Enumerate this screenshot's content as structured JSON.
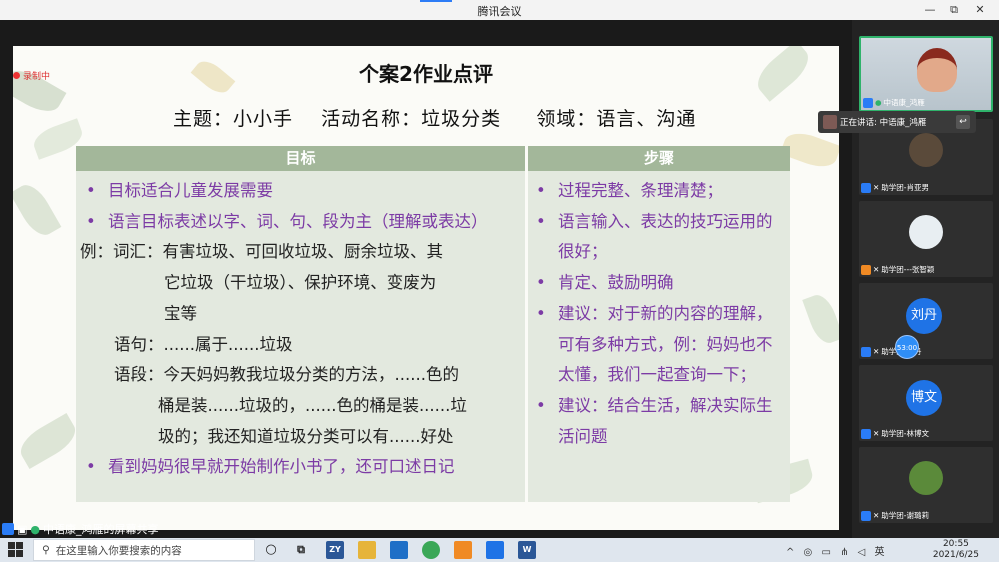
{
  "window": {
    "title": "腾讯会议",
    "controls": [
      "—",
      "□",
      "⧉",
      "✕"
    ]
  },
  "recording": {
    "label": "录制中"
  },
  "slide": {
    "title": "个案2作业点评",
    "subtitle": "主题：小小手    活动名称：垃圾分类     领域：语言、沟通",
    "table": {
      "headers": [
        "目标",
        "步骤"
      ],
      "left_lines": [
        {
          "bullet": "•",
          "text": "目标适合儿童发展需要",
          "style": "purple"
        },
        {
          "bullet": "•",
          "text": "语言目标表述以字、词、句、段为主（理解或表达）",
          "style": "purple"
        },
        {
          "bullet": "",
          "text": "例：词汇：有害垃圾、可回收垃圾、厨余垃圾、其",
          "style": "plain"
        },
        {
          "bullet": "",
          "text": "它垃圾（干垃圾）、保护环境、变废为",
          "style": "plain"
        },
        {
          "bullet": "",
          "text": "宝等",
          "style": "plain"
        },
        {
          "bullet": "",
          "text": "语句：......属于......垃圾",
          "style": "plain"
        },
        {
          "bullet": "",
          "text": "语段：今天妈妈教我垃圾分类的方法，......色的",
          "style": "plain"
        },
        {
          "bullet": "",
          "text": "桶是装......垃圾的，......色的桶是装......垃",
          "style": "plain"
        },
        {
          "bullet": "",
          "text": "圾的；我还知道垃圾分类可以有......好处",
          "style": "plain"
        },
        {
          "bullet": "•",
          "text": "看到妈妈很早就开始制作小书了，还可口述日记",
          "style": "purple"
        }
      ],
      "right_lines": [
        {
          "bullet": "•",
          "text": "过程完整、条理清楚；"
        },
        {
          "bullet": "•",
          "text": "语言输入、表达的技巧运用的"
        },
        {
          "bullet": "",
          "text": "很好；"
        },
        {
          "bullet": "•",
          "text": "肯定、鼓励明确"
        },
        {
          "bullet": "•",
          "text": "建议：对于新的内容的理解，"
        },
        {
          "bullet": "",
          "text": "可有多种方式，例：妈妈也不"
        },
        {
          "bullet": "",
          "text": "太懂，我们一起查询一下；"
        },
        {
          "bullet": "•",
          "text": "建议：结合生活，解决实际生"
        },
        {
          "bullet": "",
          "text": "活问题"
        }
      ]
    }
  },
  "speaking": {
    "label": "正在讲话: 中语康_鸿雁"
  },
  "participants": [
    {
      "name": "中语康_鸿雁",
      "avatar": ""
    },
    {
      "name": "助学团-肖亚男",
      "avatar": ""
    },
    {
      "name": "助学团---张智颖",
      "avatar": ""
    },
    {
      "name": "助学团-刘丹",
      "avatar": "刘丹"
    },
    {
      "name": "助学团-林博文",
      "avatar": "博文"
    },
    {
      "name": "助学团-谢璐莉",
      "avatar": ""
    }
  ],
  "timer": {
    "label": "53:00"
  },
  "share_bar": {
    "label": "中语康_鸿雁的屏幕共享"
  },
  "taskbar": {
    "search_placeholder": "在这里输入你要搜索的内容",
    "time": "20:55",
    "date": "2021/6/25",
    "tray_text": "^ ◎ ▭ ⋔ ◁ 英",
    "apps": [
      "ZY",
      "",
      "",
      "",
      "",
      "",
      "W"
    ]
  },
  "colors": {
    "header_green": "#a3b79a",
    "cell_bg": "#e3e9df",
    "purple_text": "#7c3ba5",
    "active_border": "#2fb36b"
  }
}
